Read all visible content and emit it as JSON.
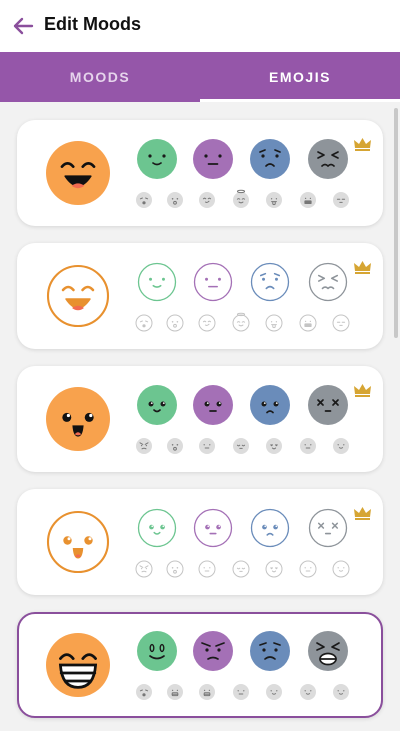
{
  "app": {
    "title": "Edit Moods"
  },
  "tabs": [
    {
      "label": "MOODS",
      "active": false
    },
    {
      "label": "EMOJIS",
      "active": true
    }
  ],
  "colors": {
    "accent": "#9556a9",
    "orange": "#f8a24d",
    "orange_line": "#e8912f",
    "green": "#6cc590",
    "purple": "#a470b6",
    "blue": "#6a8cba",
    "gray": "#8e949a",
    "crown": "#d6a533",
    "small_face": "#dcdcdc"
  },
  "cards": [
    {
      "style": "filled",
      "main": "laugh",
      "moods": [
        "smile",
        "neutral",
        "frown",
        "squint"
      ],
      "crown": true,
      "selected": false,
      "small": [
        "cry",
        "shock",
        "smirk",
        "angel",
        "tongue",
        "mask",
        "relaxed"
      ]
    },
    {
      "style": "outline",
      "main": "laugh",
      "moods": [
        "smile",
        "neutral",
        "frown",
        "squint"
      ],
      "crown": true,
      "selected": false,
      "small": [
        "cry",
        "shock",
        "smirk",
        "angel",
        "tongue",
        "mask",
        "relaxed"
      ]
    },
    {
      "style": "filled",
      "main": "cute-open",
      "moods": [
        "cute-smile",
        "cute-neutral",
        "cute-frown",
        "dead"
      ],
      "crown": true,
      "selected": false,
      "small": [
        "angry",
        "shock",
        "neutral",
        "sleepy",
        "heart",
        "neutral",
        "smile"
      ]
    },
    {
      "style": "outline",
      "main": "cute-open",
      "moods": [
        "cute-smile",
        "cute-neutral",
        "cute-frown",
        "dead"
      ],
      "crown": true,
      "selected": false,
      "small": [
        "angry",
        "shock",
        "neutral",
        "sleepy",
        "heart",
        "neutral",
        "smile"
      ]
    },
    {
      "style": "filled",
      "main": "grin-teeth",
      "moods": [
        "oval-smile",
        "grumpy",
        "worried",
        "scream"
      ],
      "crown": false,
      "selected": true,
      "small": [
        "cry",
        "grimace",
        "grimace",
        "neutral",
        "smile",
        "smile",
        "smile"
      ]
    }
  ]
}
